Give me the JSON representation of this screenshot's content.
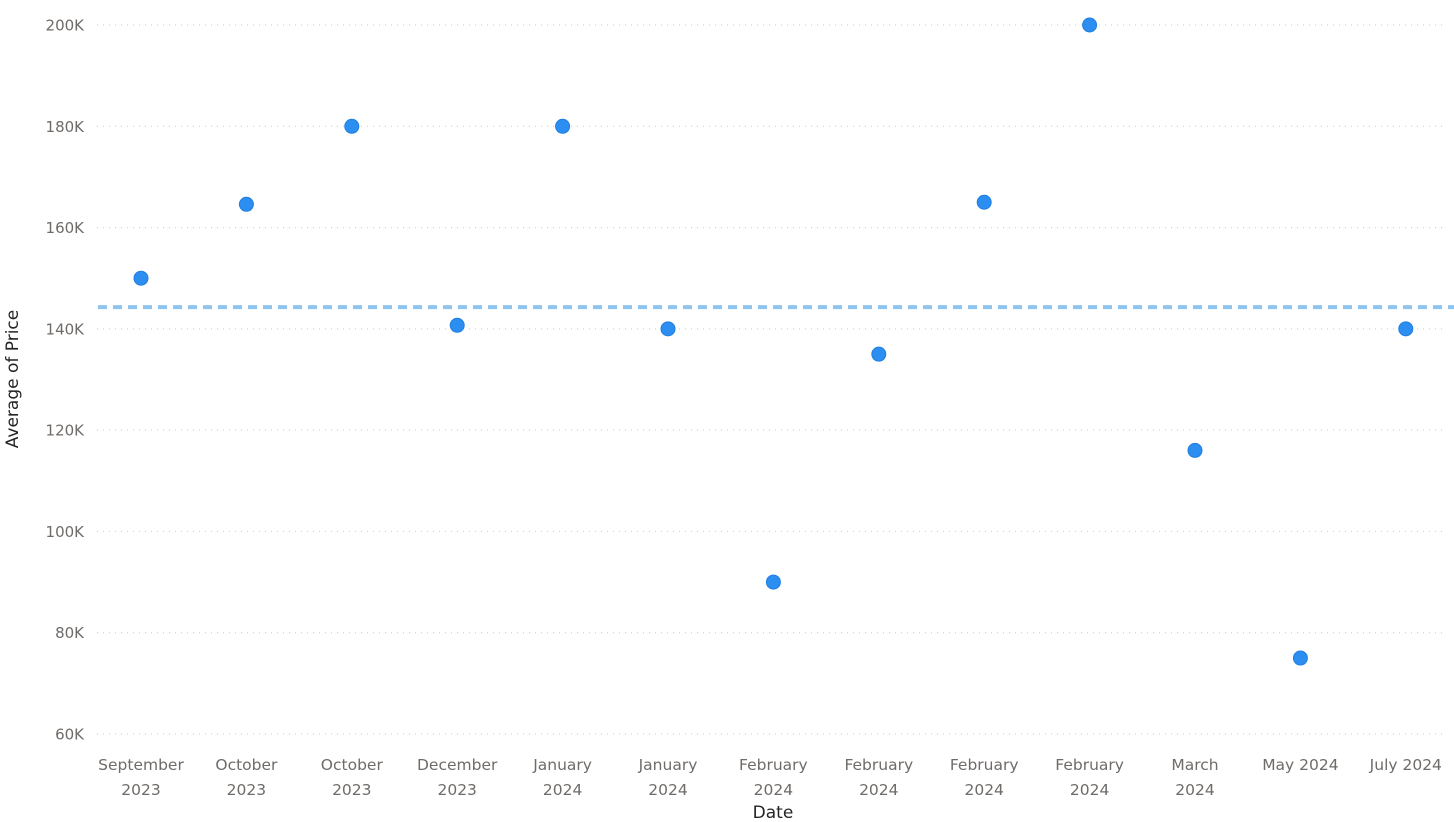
{
  "chart_data": {
    "type": "scatter",
    "title": "",
    "xlabel": "Date",
    "ylabel": "Average of Price",
    "ylim": [
      60000,
      200000
    ],
    "yticks": [
      60000,
      80000,
      100000,
      120000,
      140000,
      160000,
      180000,
      200000
    ],
    "ytick_labels": [
      "60K",
      "80K",
      "100K",
      "120K",
      "140K",
      "160K",
      "180K",
      "200K"
    ],
    "grid": true,
    "categories": [
      [
        "September",
        "2023"
      ],
      [
        "October",
        "2023"
      ],
      [
        "October",
        "2023"
      ],
      [
        "December",
        "2023"
      ],
      [
        "January",
        "2024"
      ],
      [
        "January",
        "2024"
      ],
      [
        "February",
        "2024"
      ],
      [
        "February",
        "2024"
      ],
      [
        "February",
        "2024"
      ],
      [
        "February",
        "2024"
      ],
      [
        "March",
        "2024"
      ],
      [
        "May 2024"
      ],
      [
        "July 2024"
      ]
    ],
    "series": [
      {
        "name": "Average of Price",
        "color": "#2b8ef0",
        "values": [
          150000,
          164600,
          180000,
          140700,
          180000,
          140000,
          90000,
          135000,
          165000,
          200000,
          116000,
          75000,
          140000
        ]
      }
    ],
    "reference_lines": [
      {
        "name": "Average line",
        "type": "average",
        "value": 144300,
        "color": "#8ec5f0",
        "style": "dashed"
      }
    ]
  }
}
